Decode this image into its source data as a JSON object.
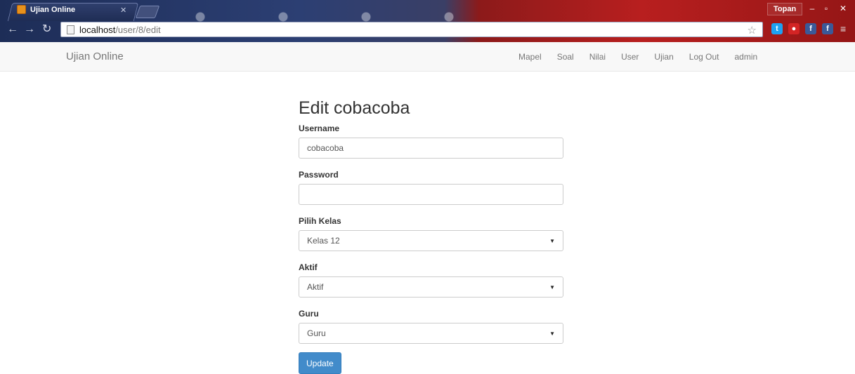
{
  "browser": {
    "tab_title": "Ujian Online",
    "url_host": "localhost",
    "url_path": "/user/8/edit",
    "window_user": "Topan",
    "controls": {
      "minimize": "–",
      "restore": "▫",
      "close": "✕"
    },
    "extensions": [
      {
        "name": "twitter-extension-icon",
        "color": "#1da1f2",
        "glyph": "t"
      },
      {
        "name": "adblock-extension-icon",
        "color": "#d32424",
        "glyph": "●"
      },
      {
        "name": "facebook-extension-icon",
        "color": "#3b5998",
        "glyph": "f"
      },
      {
        "name": "facebook-extension-icon-2",
        "color": "#3b5998",
        "glyph": "f"
      }
    ]
  },
  "navbar": {
    "brand": "Ujian Online",
    "links": [
      "Mapel",
      "Soal",
      "Nilai",
      "User",
      "Ujian",
      "Log Out",
      "admin"
    ]
  },
  "form": {
    "title": "Edit cobacoba",
    "username_label": "Username",
    "username_value": "cobacoba",
    "password_label": "Password",
    "password_value": "",
    "kelas_label": "Pilih Kelas",
    "kelas_value": "Kelas 12",
    "aktif_label": "Aktif",
    "aktif_value": "Aktif",
    "guru_label": "Guru",
    "guru_value": "Guru",
    "submit_label": "Update"
  },
  "colors": {
    "primary_button": "#428bca",
    "navbar_bg": "#f8f8f8",
    "text_muted": "#777777"
  }
}
